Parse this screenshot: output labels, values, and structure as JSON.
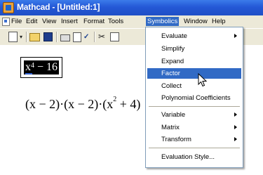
{
  "window": {
    "title": "Mathcad - [Untitled:1]"
  },
  "menubar": {
    "items": [
      "File",
      "Edit",
      "View",
      "Insert",
      "Format",
      "Tools",
      "Symbolics",
      "Window",
      "Help"
    ],
    "active": "Symbolics"
  },
  "toolbar": {
    "icons": [
      "new-icon",
      "dropdown-icon",
      "open-icon",
      "save-icon",
      "print-icon",
      "print-preview-icon",
      "spell-check-icon",
      "cut-icon",
      "copy-icon"
    ]
  },
  "worksheet": {
    "selected_expression": {
      "base": "x",
      "exponent": "4",
      "rest": " − 16"
    },
    "result": {
      "part1": "(x − 2)·(x − 2)·(x",
      "exponent": "2",
      "part2": " + 4)"
    }
  },
  "symbolics_menu": {
    "items": [
      {
        "label": "Evaluate",
        "submenu": true
      },
      {
        "label": "Simplify",
        "submenu": false
      },
      {
        "label": "Expand",
        "submenu": false
      },
      {
        "label": "Factor",
        "submenu": false,
        "highlighted": true
      },
      {
        "label": "Collect",
        "submenu": false
      },
      {
        "label": "Polynomial Coefficients",
        "submenu": false
      },
      {
        "label": "Variable",
        "submenu": true
      },
      {
        "label": "Matrix",
        "submenu": true
      },
      {
        "label": "Transform",
        "submenu": true
      },
      {
        "label": "Evaluation Style...",
        "submenu": false
      }
    ]
  },
  "colors": {
    "titlebar": "#2458d6",
    "highlight": "#316ac5",
    "menu_bg": "#ece9d8"
  }
}
